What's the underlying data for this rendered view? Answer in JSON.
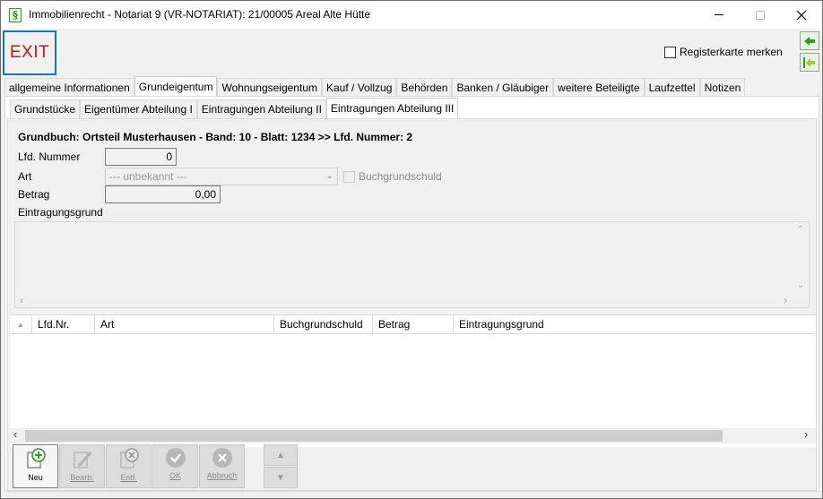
{
  "window": {
    "title": "Immobilienrecht - Notariat 9 (VR-NOTARIAT): 21/00005 Areal Alte Hütte",
    "app_icon": "§"
  },
  "toolbar": {
    "exit_label": "EXIT",
    "remember_tab_label": "Registerkarte merken",
    "remember_tab_checked": false
  },
  "main_tabs": [
    {
      "label": "allgemeine Informationen",
      "active": false
    },
    {
      "label": "Grundeigentum",
      "active": true
    },
    {
      "label": "Wohnungseigentum",
      "active": false
    },
    {
      "label": "Kauf / Vollzug",
      "active": false
    },
    {
      "label": "Behörden",
      "active": false
    },
    {
      "label": "Banken / Gläubiger",
      "active": false
    },
    {
      "label": "weitere Beteiligte",
      "active": false
    },
    {
      "label": "Laufzettel",
      "active": false
    },
    {
      "label": "Notizen",
      "active": false
    }
  ],
  "sub_tabs": [
    {
      "label": "Grundstücke",
      "active": false
    },
    {
      "label": "Eigentümer Abteilung I",
      "active": false
    },
    {
      "label": "Eintragungen Abteilung II",
      "active": false
    },
    {
      "label": "Eintragungen Abteilung III",
      "active": true
    }
  ],
  "form": {
    "grundbuch_line": "Grundbuch: Ortsteil Musterhausen - Band: 10 - Blatt: 1234 >> Lfd. Nummer: 2",
    "lfd_nummer_label": "Lfd. Nummer",
    "lfd_nummer_value": "0",
    "art_label": "Art",
    "art_value": "--- unbekannt ---",
    "buchgrundschuld_label": "Buchgrundschuld",
    "buchgrundschuld_checked": false,
    "betrag_label": "Betrag",
    "betrag_value": "0,00",
    "eintragungsgrund_label": "Eintragungsgrund",
    "eintragungsgrund_value": ""
  },
  "grid": {
    "columns": [
      "Lfd.Nr.",
      "Art",
      "Buchgrundschuld",
      "Betrag",
      "Eintragungsgrund"
    ],
    "rows": []
  },
  "bottom_buttons": {
    "neu": "Neu",
    "bearb": "Bearb.",
    "entf": "Entf.",
    "ok": "OK",
    "abbruch": "Abbruch"
  },
  "colors": {
    "exit_text": "#d01010",
    "exit_border": "#1a73c7",
    "nav_arrow": "#2e9b2e",
    "neu_plus": "#2e9b2e"
  }
}
